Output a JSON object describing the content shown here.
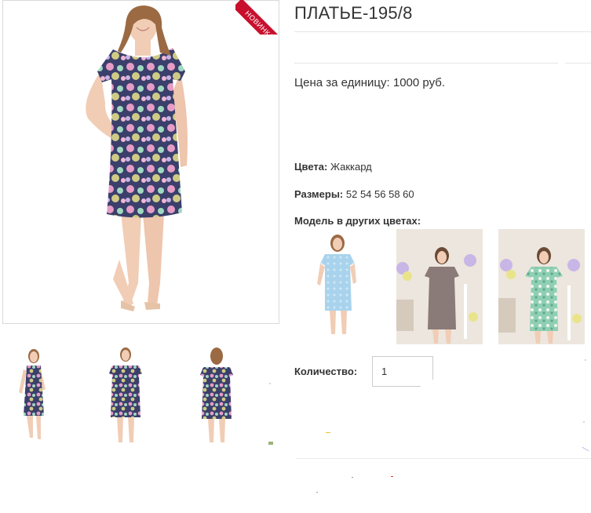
{
  "product": {
    "title": "ПЛАТЬЕ-195/8",
    "badge": "НОВИНКА",
    "unit_price_label": "Цена за единицу: 1000 руб."
  },
  "specs": {
    "colors_label": "Цвета:",
    "colors_value": "Жаккард",
    "sizes_label": "Размеры:",
    "sizes_value": "52 54 56 58 60"
  },
  "other_colors": {
    "label": "Модель в других цветах:",
    "items": [
      {
        "name": "light-blue-dress",
        "color": "#a9d3ec"
      },
      {
        "name": "taupe-dress",
        "color": "#8a7a78"
      },
      {
        "name": "mint-dress",
        "color": "#8fcfb4"
      }
    ]
  },
  "quantity": {
    "label": "Количество:",
    "value": "1"
  },
  "colors": {
    "badge_red": "#c8102e",
    "print_navy": "#3b3f6b",
    "print_pink": "#e59cc6",
    "print_mint": "#9fd8c0",
    "print_yellow": "#e9e48a",
    "skin": "#f1cdb6",
    "hair": "#9b6a43"
  }
}
